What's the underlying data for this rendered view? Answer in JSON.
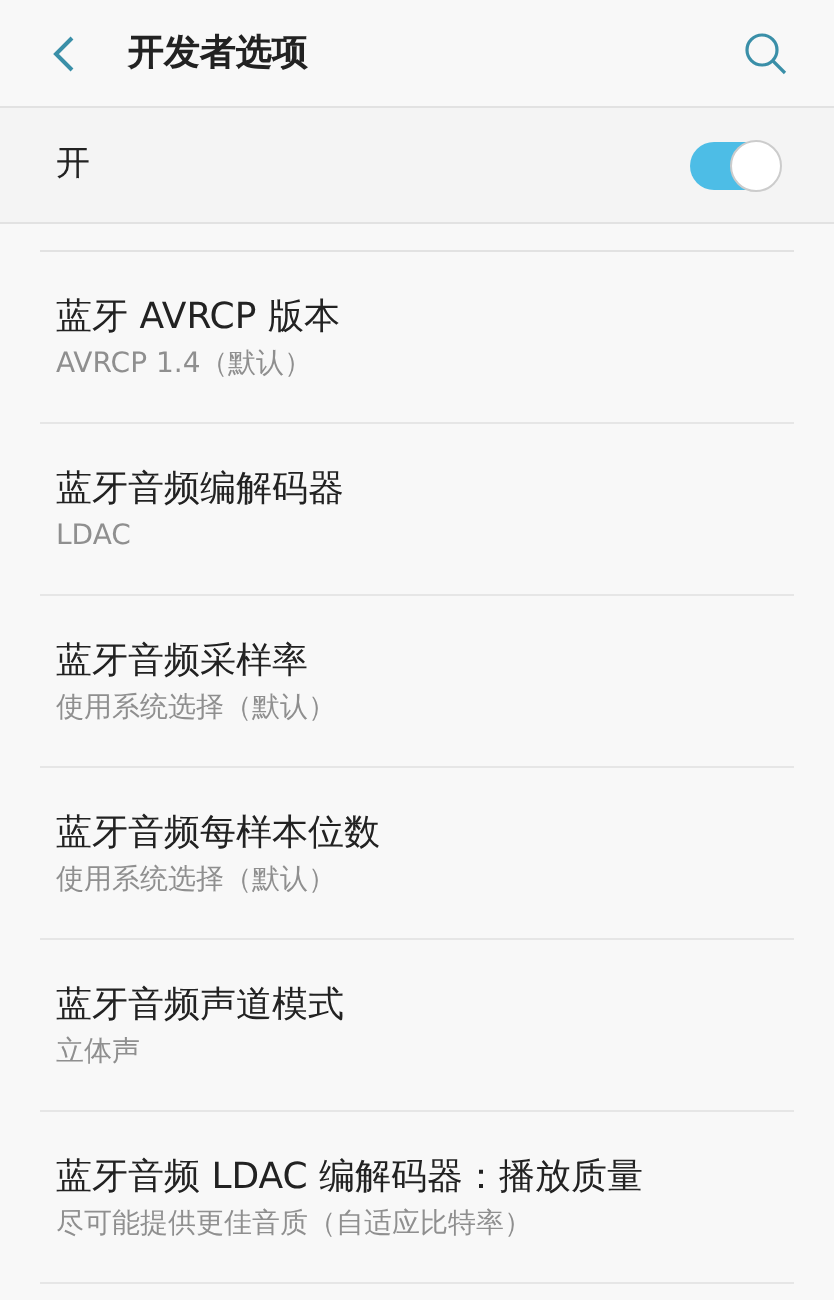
{
  "header": {
    "title": "开发者选项"
  },
  "master_switch": {
    "label": "开",
    "on": true
  },
  "settings": [
    {
      "title": "蓝牙 AVRCP 版本",
      "summary": "AVRCP 1.4（默认）"
    },
    {
      "title": "蓝牙音频编解码器",
      "summary": "LDAC"
    },
    {
      "title": "蓝牙音频采样率",
      "summary": "使用系统选择（默认）"
    },
    {
      "title": "蓝牙音频每样本位数",
      "summary": "使用系统选择（默认）"
    },
    {
      "title": "蓝牙音频声道模式",
      "summary": "立体声"
    },
    {
      "title": "蓝牙音频 LDAC 编解码器：播放质量",
      "summary": "尽可能提供更佳音质（自适应比特率）"
    }
  ]
}
